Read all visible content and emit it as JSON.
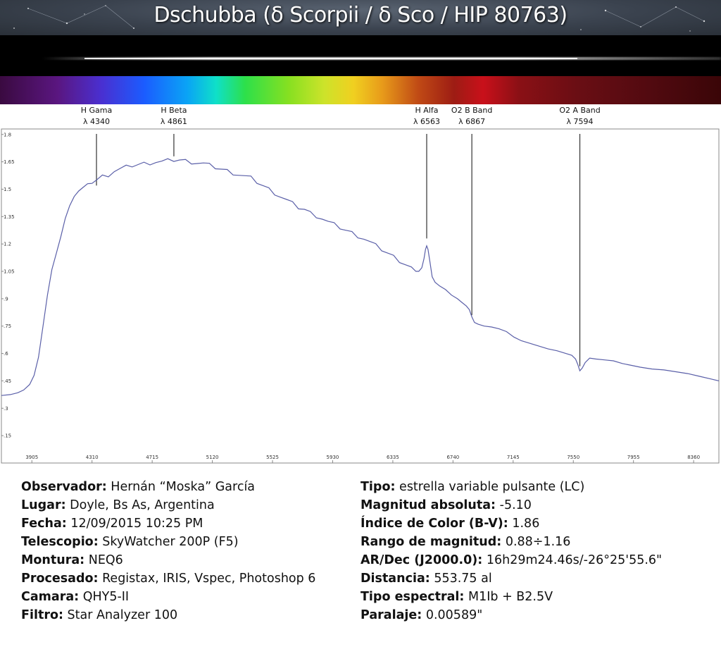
{
  "title": "Dschubba (δ Scorpii / δ Sco / HIP 80763)",
  "colors": {
    "line": "#5a5fa8",
    "axis": "#888888",
    "text": "#111111"
  },
  "chart_data": {
    "type": "line",
    "xlim": [
      3700,
      8530
    ],
    "ylim": [
      0,
      1.83
    ],
    "x_ticks": [
      3905,
      4310,
      4715,
      5120,
      5525,
      5930,
      6335,
      6740,
      7145,
      7550,
      7955,
      8360
    ],
    "y_ticks": [
      0.15,
      0.3,
      0.45,
      0.6,
      0.75,
      0.9,
      1.05,
      1.2,
      1.35,
      1.5,
      1.65,
      1.8
    ],
    "y_tick_labels": [
      ".15",
      ".3",
      ".45",
      ".6",
      ".75",
      ".9",
      "1.05",
      "1.2",
      "1.35",
      "1.5",
      "1.65",
      "1.8"
    ],
    "series": [
      {
        "x": [
          3700,
          3760,
          3810,
          3850,
          3890,
          3920,
          3950,
          3980,
          4010,
          4040,
          4070,
          4100,
          4130,
          4160,
          4190,
          4220,
          4250,
          4280,
          4310,
          4340,
          4380,
          4420,
          4460,
          4500,
          4540,
          4580,
          4620,
          4660,
          4700,
          4740,
          4780,
          4820,
          4861,
          4900,
          4940,
          4980,
          5020,
          5060,
          5100,
          5140,
          5180,
          5220,
          5260,
          5300,
          5340,
          5380,
          5420,
          5460,
          5500,
          5540,
          5580,
          5620,
          5660,
          5700,
          5740,
          5780,
          5820,
          5860,
          5900,
          5940,
          5980,
          6020,
          6060,
          6100,
          6140,
          6180,
          6220,
          6260,
          6300,
          6340,
          6380,
          6420,
          6460,
          6490,
          6510,
          6530,
          6545,
          6555,
          6563,
          6572,
          6585,
          6600,
          6620,
          6650,
          6690,
          6730,
          6770,
          6800,
          6830,
          6850,
          6867,
          6885,
          6910,
          6950,
          7000,
          7050,
          7100,
          7150,
          7200,
          7260,
          7320,
          7380,
          7440,
          7500,
          7540,
          7565,
          7580,
          7594,
          7610,
          7630,
          7660,
          7700,
          7760,
          7820,
          7880,
          7940,
          8000,
          8080,
          8160,
          8240,
          8320,
          8400,
          8480,
          8530
        ],
        "y": [
          0.37,
          0.375,
          0.385,
          0.4,
          0.43,
          0.48,
          0.58,
          0.75,
          0.92,
          1.06,
          1.15,
          1.24,
          1.34,
          1.41,
          1.46,
          1.49,
          1.51,
          1.53,
          1.54,
          1.55,
          1.57,
          1.58,
          1.6,
          1.61,
          1.62,
          1.63,
          1.635,
          1.64,
          1.645,
          1.65,
          1.65,
          1.655,
          1.66,
          1.66,
          1.655,
          1.65,
          1.645,
          1.64,
          1.63,
          1.62,
          1.61,
          1.6,
          1.59,
          1.58,
          1.57,
          1.56,
          1.54,
          1.52,
          1.5,
          1.48,
          1.46,
          1.44,
          1.42,
          1.4,
          1.39,
          1.37,
          1.355,
          1.34,
          1.32,
          1.305,
          1.29,
          1.275,
          1.26,
          1.245,
          1.23,
          1.21,
          1.19,
          1.17,
          1.15,
          1.13,
          1.11,
          1.09,
          1.07,
          1.05,
          1.05,
          1.07,
          1.12,
          1.17,
          1.19,
          1.17,
          1.1,
          1.02,
          0.99,
          0.97,
          0.95,
          0.92,
          0.9,
          0.88,
          0.86,
          0.84,
          0.8,
          0.77,
          0.76,
          0.75,
          0.745,
          0.735,
          0.72,
          0.69,
          0.67,
          0.655,
          0.64,
          0.625,
          0.615,
          0.6,
          0.59,
          0.57,
          0.54,
          0.505,
          0.52,
          0.55,
          0.575,
          0.57,
          0.565,
          0.56,
          0.545,
          0.535,
          0.525,
          0.515,
          0.51,
          0.5,
          0.49,
          0.475,
          0.46,
          0.45
        ]
      }
    ],
    "annotations": [
      {
        "name": "H Gama",
        "wavelength_label": "λ 4340",
        "x": 4340,
        "y_bottom": 1.52
      },
      {
        "name": "H Beta",
        "wavelength_label": "λ 4861",
        "x": 4861,
        "y_bottom": 1.68
      },
      {
        "name": "H Alfa",
        "wavelength_label": "λ 6563",
        "x": 6563,
        "y_bottom": 1.23
      },
      {
        "name": "O2 B Band",
        "wavelength_label": "λ 6867",
        "x": 6867,
        "y_bottom": 0.81
      },
      {
        "name": "O2 A Band",
        "wavelength_label": "λ 7594",
        "x": 7594,
        "y_bottom": 0.53
      }
    ],
    "grid": false
  },
  "info": {
    "left": [
      {
        "label": "Observador:",
        "value": "Hernán “Moska” García"
      },
      {
        "label": "Lugar:",
        "value": "Doyle, Bs As, Argentina"
      },
      {
        "label": "Fecha:",
        "value": "12/09/2015 10:25 PM"
      },
      {
        "label": "Telescopio:",
        "value": "SkyWatcher 200P (F5)"
      },
      {
        "label": "Montura:",
        "value": "NEQ6"
      },
      {
        "label": "Procesado:",
        "value": "Registax, IRIS, Vspec, Photoshop 6"
      },
      {
        "label": "Camara:",
        "value": "QHY5-II"
      },
      {
        "label": "Filtro:",
        "value": "Star Analyzer 100"
      }
    ],
    "right": [
      {
        "label": "Tipo:",
        "value": "estrella variable pulsante (LC)"
      },
      {
        "label": "Magnitud absoluta:",
        "value": "-5.10"
      },
      {
        "label": "Índice de Color (B-V):",
        "value": "1.86"
      },
      {
        "label": "Rango de magnitud:",
        "value": "0.88÷1.16"
      },
      {
        "label": "AR/Dec (J2000.0):",
        "value": "16h29m24.46s/-26°25'55.6\""
      },
      {
        "label": "Distancia:",
        "value": "553.75 al"
      },
      {
        "label": "Tipo espectral:",
        "value": "M1Ib + B2.5V"
      },
      {
        "label": "Paralaje:",
        "value": "0.00589\""
      }
    ]
  }
}
